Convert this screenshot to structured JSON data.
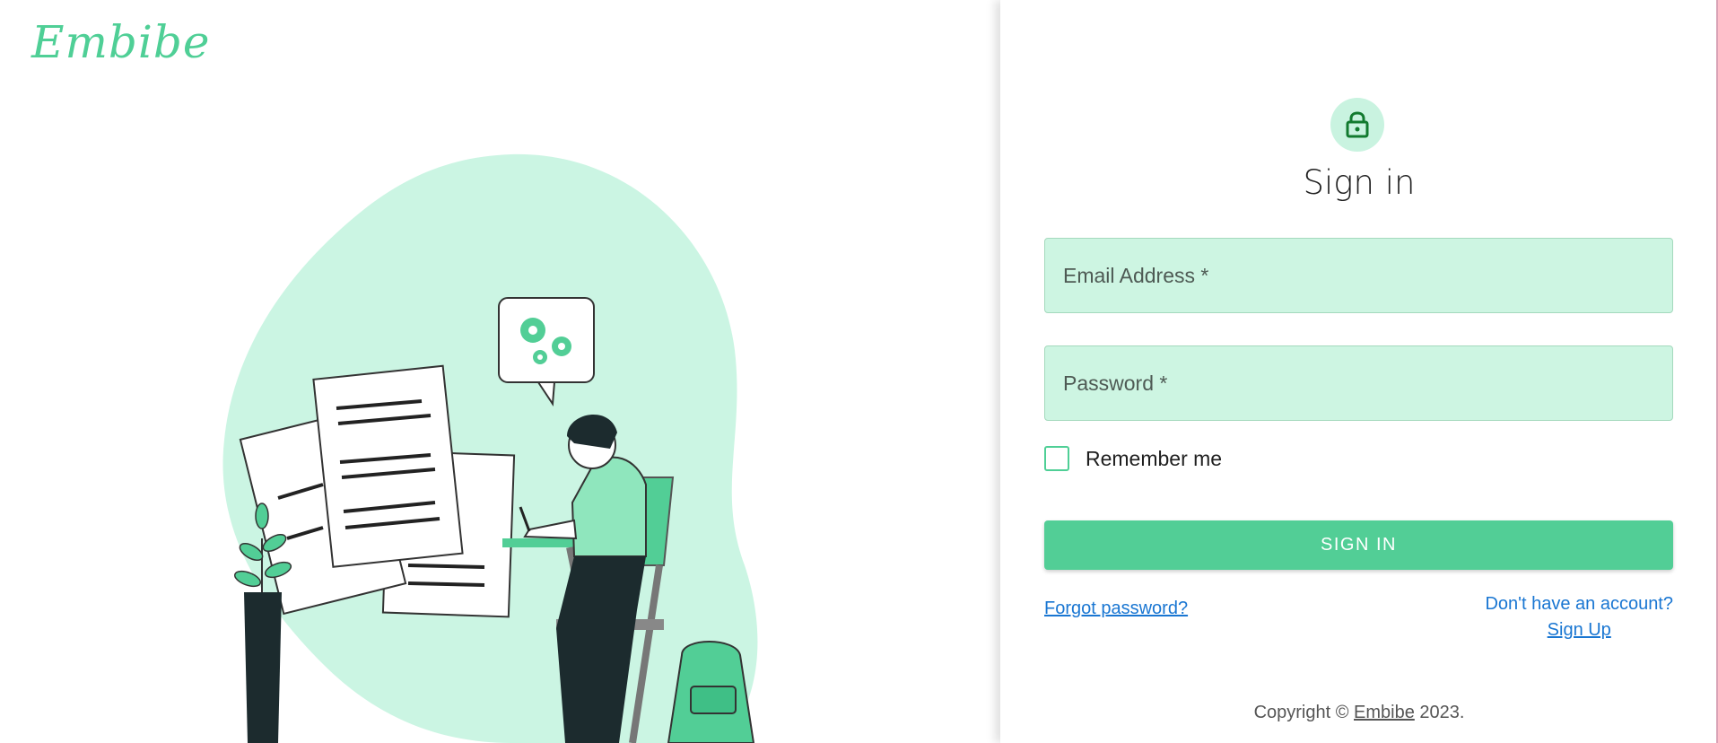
{
  "brand": {
    "logo_text": "Embibe",
    "accent_color": "#52ce96"
  },
  "signin": {
    "title": "Sign in",
    "lock_icon": "lock-icon",
    "email_placeholder": "Email Address *",
    "password_placeholder": "Password *",
    "remember_label": "Remember me",
    "remember_checked": false,
    "submit_label": "SIGN IN",
    "forgot_link": "Forgot password?",
    "signup_question": "Don't have an account?",
    "signup_link": "Sign Up"
  },
  "footer": {
    "copyright_prefix": "Copyright © ",
    "copyright_link": "Embibe",
    "copyright_suffix": " 2023."
  },
  "colors": {
    "field_bg": "#cdf5e2",
    "blob": "#cbf5e3",
    "link": "#1976d2",
    "button": "#52ce96"
  }
}
